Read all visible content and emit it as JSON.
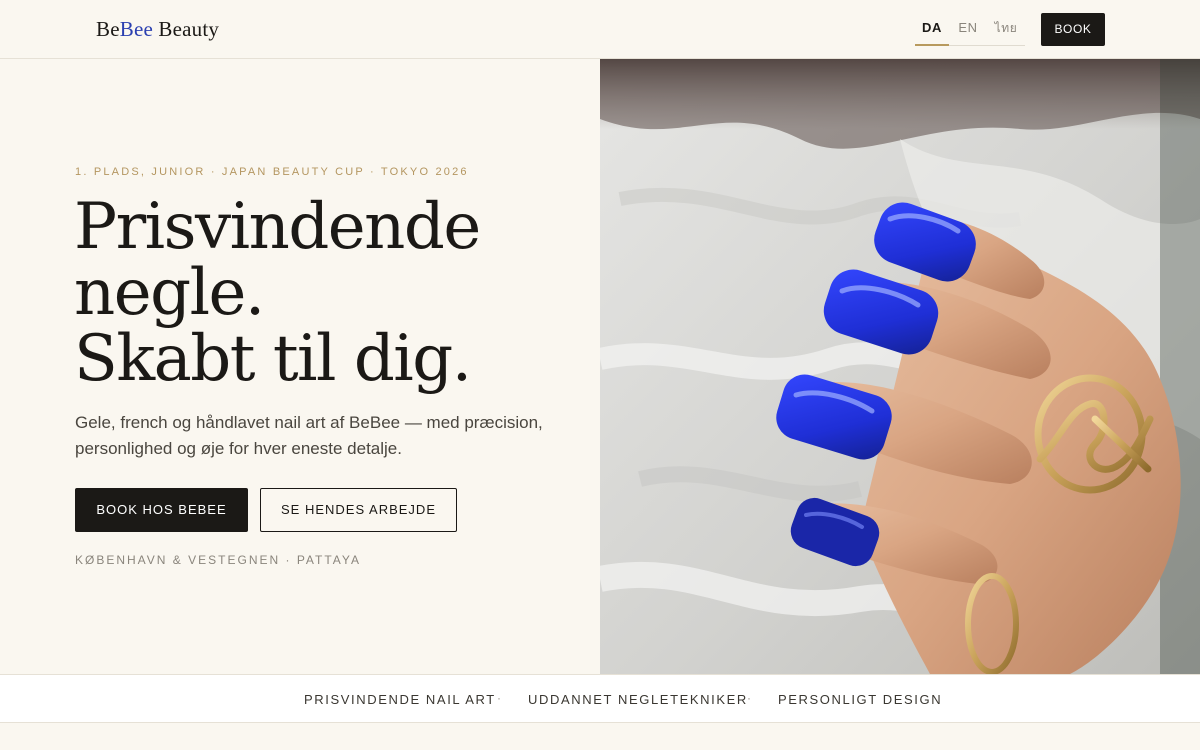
{
  "header": {
    "logo": {
      "part1": "Be",
      "part2": "Bee",
      "part3": " Beauty"
    },
    "languages": [
      "DA",
      "EN",
      "ไทย"
    ],
    "active_language": "DA",
    "book_label": "BOOK"
  },
  "hero": {
    "kicker": "1. PLADS, JUNIOR · JAPAN BEAUTY CUP · TOKYO 2026",
    "headline": [
      "Prisvindende",
      "negle.",
      "Skabt til dig."
    ],
    "lead": "Gele, french og håndlavet nail art af BeBee — med præcision, personlighed og øje for hver eneste detalje.",
    "primary_button": "BOOK HOS BEBEE",
    "secondary_button": "SE HENDES ARBEJDE",
    "locations": "KØBENHAVN & VESTEGNEN · PATTAYA"
  },
  "features": {
    "items": [
      "PRISVINDENDE NAIL ART",
      "UDDANNET NEGLETEKNIKER",
      "PERSONLIGT DESIGN"
    ],
    "separator": "·"
  },
  "colors": {
    "background": "#faf7f0",
    "ink": "#1b1916",
    "gold": "#b49660",
    "brand_blue": "#2a3fb0",
    "nail_blue": "#1f2fd6"
  }
}
